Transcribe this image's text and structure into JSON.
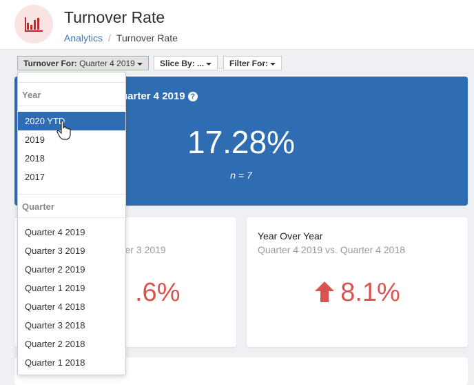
{
  "header": {
    "title": "Turnover Rate",
    "breadcrumb": [
      "Analytics",
      "Turnover Rate"
    ],
    "icon": "bar-chart-icon",
    "icon_color": "#c0282d"
  },
  "toolbar": {
    "turnover_label": "Turnover For:",
    "turnover_value": "Quarter 4 2019",
    "slice_label": "Slice By: ...",
    "filter_label": "Filter For:"
  },
  "main_card": {
    "title_visible": "uarter 4 2019",
    "value": "17.28%",
    "n": "n = 7",
    "color": "#2f6db3"
  },
  "left_card": {
    "subtitle_visible": "rter 3 2019",
    "value_visible": ".6%"
  },
  "right_card": {
    "title": "Year Over Year",
    "subtitle": "Quarter 4 2019 vs. Quarter 4 2018",
    "value": "8.1%",
    "trend": "up",
    "trend_color": "#d9534f"
  },
  "dropdown": {
    "year_header": "Year",
    "years": [
      "2020 YTD",
      "2019",
      "2018",
      "2017"
    ],
    "selected": "2020 YTD",
    "quarter_header": "Quarter",
    "quarters": [
      "Quarter 4 2019",
      "Quarter 3 2019",
      "Quarter 2 2019",
      "Quarter 1 2019",
      "Quarter 4 2018",
      "Quarter 3 2018",
      "Quarter 2 2018",
      "Quarter 1 2018"
    ]
  }
}
